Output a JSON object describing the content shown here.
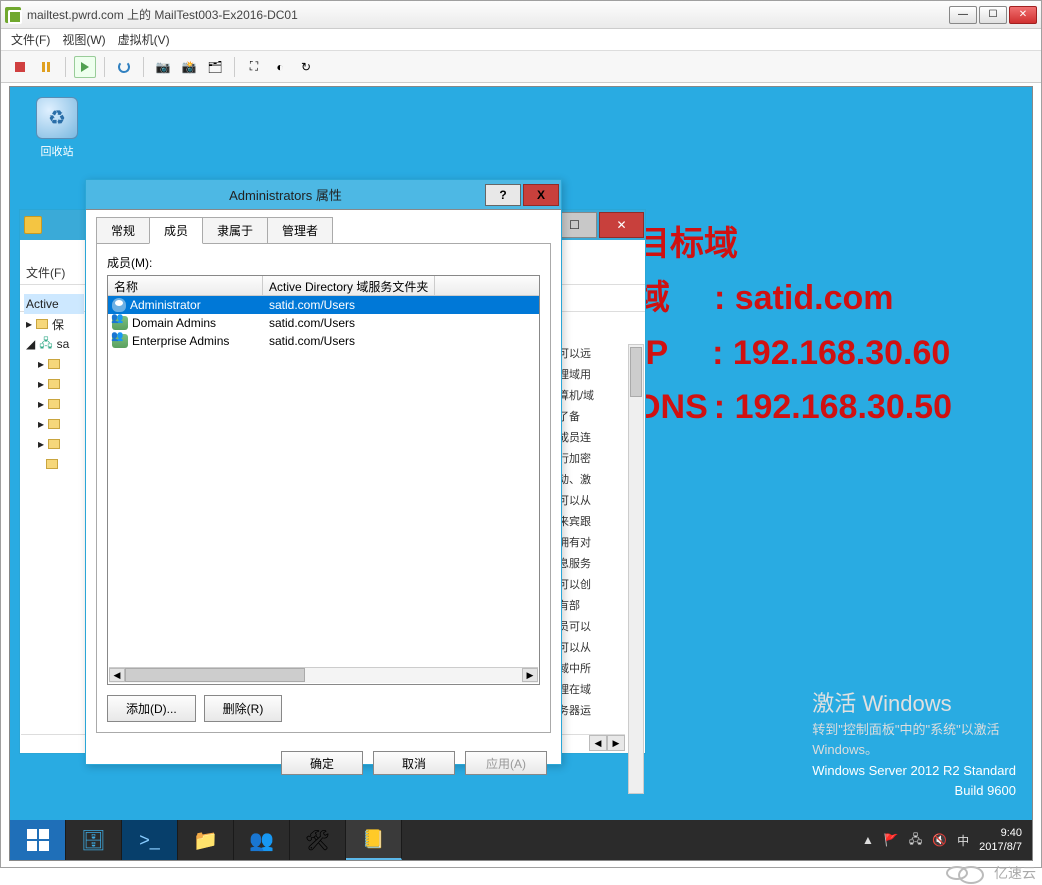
{
  "vmware": {
    "title": "mailtest.pwrd.com 上的 MailTest003-Ex2016-DC01",
    "menus": [
      "文件(F)",
      "视图(W)",
      "虚拟机(V)"
    ]
  },
  "recycle_label": "回收站",
  "overlay": {
    "heading": "目标域",
    "rows": [
      {
        "k": "域",
        "v": ": satid.com"
      },
      {
        "k": "IP",
        "v": ": 192.168.30.60"
      },
      {
        "k": "DNS",
        "v": ": 192.168.30.50"
      }
    ]
  },
  "bg_window": {
    "file_menu": "文件(F)",
    "tree": [
      "Active",
      "▸ 📁 保",
      "◢ 🖧 sa"
    ],
    "right_lines": [
      "员可以远",
      "管理域用",
      "计算机/域",
      "为了备",
      "的成员连",
      "执行加密",
      "启动、激",
      "员可以从",
      "，来宾跟",
      "员拥有对",
      "信息服务",
      "员可以创",
      "员有部",
      "成员可以",
      "员可以从",
      "在域中所",
      "管理在域",
      "服务器运"
    ]
  },
  "dialog": {
    "title": "Administrators 属性",
    "help": "?",
    "close": "X",
    "tabs": [
      "常规",
      "成员",
      "隶属于",
      "管理者"
    ],
    "active_tab": 1,
    "members_label": "成员(M):",
    "cols": [
      "名称",
      "Active Directory 域服务文件夹"
    ],
    "rows": [
      {
        "icon": "person",
        "name": "Administrator",
        "folder": "satid.com/Users",
        "selected": true
      },
      {
        "icon": "group",
        "name": "Domain Admins",
        "folder": "satid.com/Users",
        "selected": false
      },
      {
        "icon": "group",
        "name": "Enterprise Admins",
        "folder": "satid.com/Users",
        "selected": false
      }
    ],
    "add_btn": "添加(D)...",
    "remove_btn": "删除(R)",
    "ok": "确定",
    "cancel": "取消",
    "apply": "应用(A)"
  },
  "watermark": {
    "title": "激活 Windows",
    "sub1": "转到\"控制面板\"中的\"系统\"以激活",
    "sub2": "Windows。",
    "os1": "Windows Server 2012 R2 Standard",
    "os2": "Build 9600"
  },
  "tray": {
    "time": "9:40",
    "date": "2017/8/7",
    "chevron": "▲"
  },
  "brand": "亿速云"
}
